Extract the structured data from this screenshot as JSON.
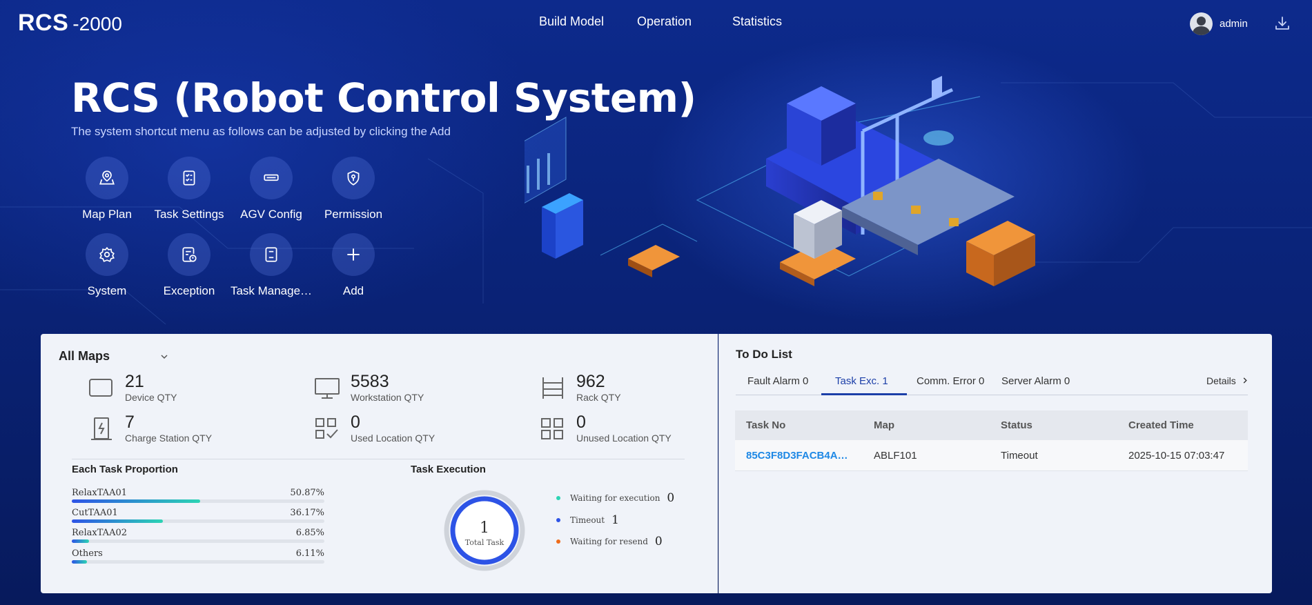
{
  "app": {
    "logo_main": "RCS",
    "logo_sub": "-2000"
  },
  "nav": [
    {
      "label": "Build Model"
    },
    {
      "label": "Operation"
    },
    {
      "label": "Statistics"
    }
  ],
  "user": {
    "name": "admin"
  },
  "hero": {
    "title": "RCS (Robot Control System)",
    "subtitle": "The system shortcut menu as follows can be adjusted by clicking the Add"
  },
  "shortcuts": [
    {
      "label": "Map Plan",
      "icon": "map-pin-icon"
    },
    {
      "label": "Task Settings",
      "icon": "checklist-icon"
    },
    {
      "label": "AGV Config",
      "icon": "agv-icon"
    },
    {
      "label": "Permission",
      "icon": "shield-key-icon"
    },
    {
      "label": "System",
      "icon": "gear-icon"
    },
    {
      "label": "Exception",
      "icon": "exception-icon"
    },
    {
      "label": "Task Manage…",
      "icon": "document-icon"
    },
    {
      "label": "Add",
      "icon": "plus-icon"
    }
  ],
  "maps": {
    "selected": "All Maps",
    "stats": [
      {
        "value": "21",
        "label": "Device QTY",
        "icon": "device-icon"
      },
      {
        "value": "5583",
        "label": "Workstation QTY",
        "icon": "monitor-icon"
      },
      {
        "value": "962",
        "label": "Rack QTY",
        "icon": "rack-icon"
      },
      {
        "value": "7",
        "label": "Charge Station QTY",
        "icon": "charge-station-icon"
      },
      {
        "value": "0",
        "label": "Used Location QTY",
        "icon": "used-location-icon"
      },
      {
        "value": "0",
        "label": "Unused Location QTY",
        "icon": "unused-location-icon"
      }
    ]
  },
  "proportion": {
    "title": "Each Task Proportion",
    "items": [
      {
        "name": "RelaxTAA01",
        "pct_label": "50.87%",
        "value": 50.87
      },
      {
        "name": "CutTAA01",
        "pct_label": "36.17%",
        "value": 36.17
      },
      {
        "name": "RelaxTAA02",
        "pct_label": "6.85%",
        "value": 6.85
      },
      {
        "name": "Others",
        "pct_label": "6.11%",
        "value": 6.11
      }
    ]
  },
  "execution": {
    "title": "Task Execution",
    "total": "1",
    "total_label": "Total Task",
    "legend": [
      {
        "label": "Waiting for execution",
        "value": "0",
        "color": "#2cd4b4"
      },
      {
        "label": "Timeout",
        "value": "1",
        "color": "#2d53e6"
      },
      {
        "label": "Waiting for resend",
        "value": "0",
        "color": "#ef6c1a"
      }
    ]
  },
  "todo": {
    "title": "To Do List",
    "tabs": [
      {
        "label": "Fault Alarm",
        "count": "0"
      },
      {
        "label": "Task Exc.",
        "count": "1"
      },
      {
        "label": "Comm. Error",
        "count": "0"
      },
      {
        "label": "Server Alarm",
        "count": "0"
      }
    ],
    "details_label": "Details",
    "columns": [
      "Task No",
      "Map",
      "Status",
      "Created Time"
    ],
    "rows": [
      [
        "85C3F8D3FACB4A…",
        "ABLF101",
        "Timeout",
        "2025-10-15 07:03:47"
      ]
    ]
  },
  "colors": {
    "accent": "#1c3fa8",
    "link": "#1e88e5",
    "bar_start": "#2d53e6",
    "bar_end": "#2cd4b4"
  }
}
